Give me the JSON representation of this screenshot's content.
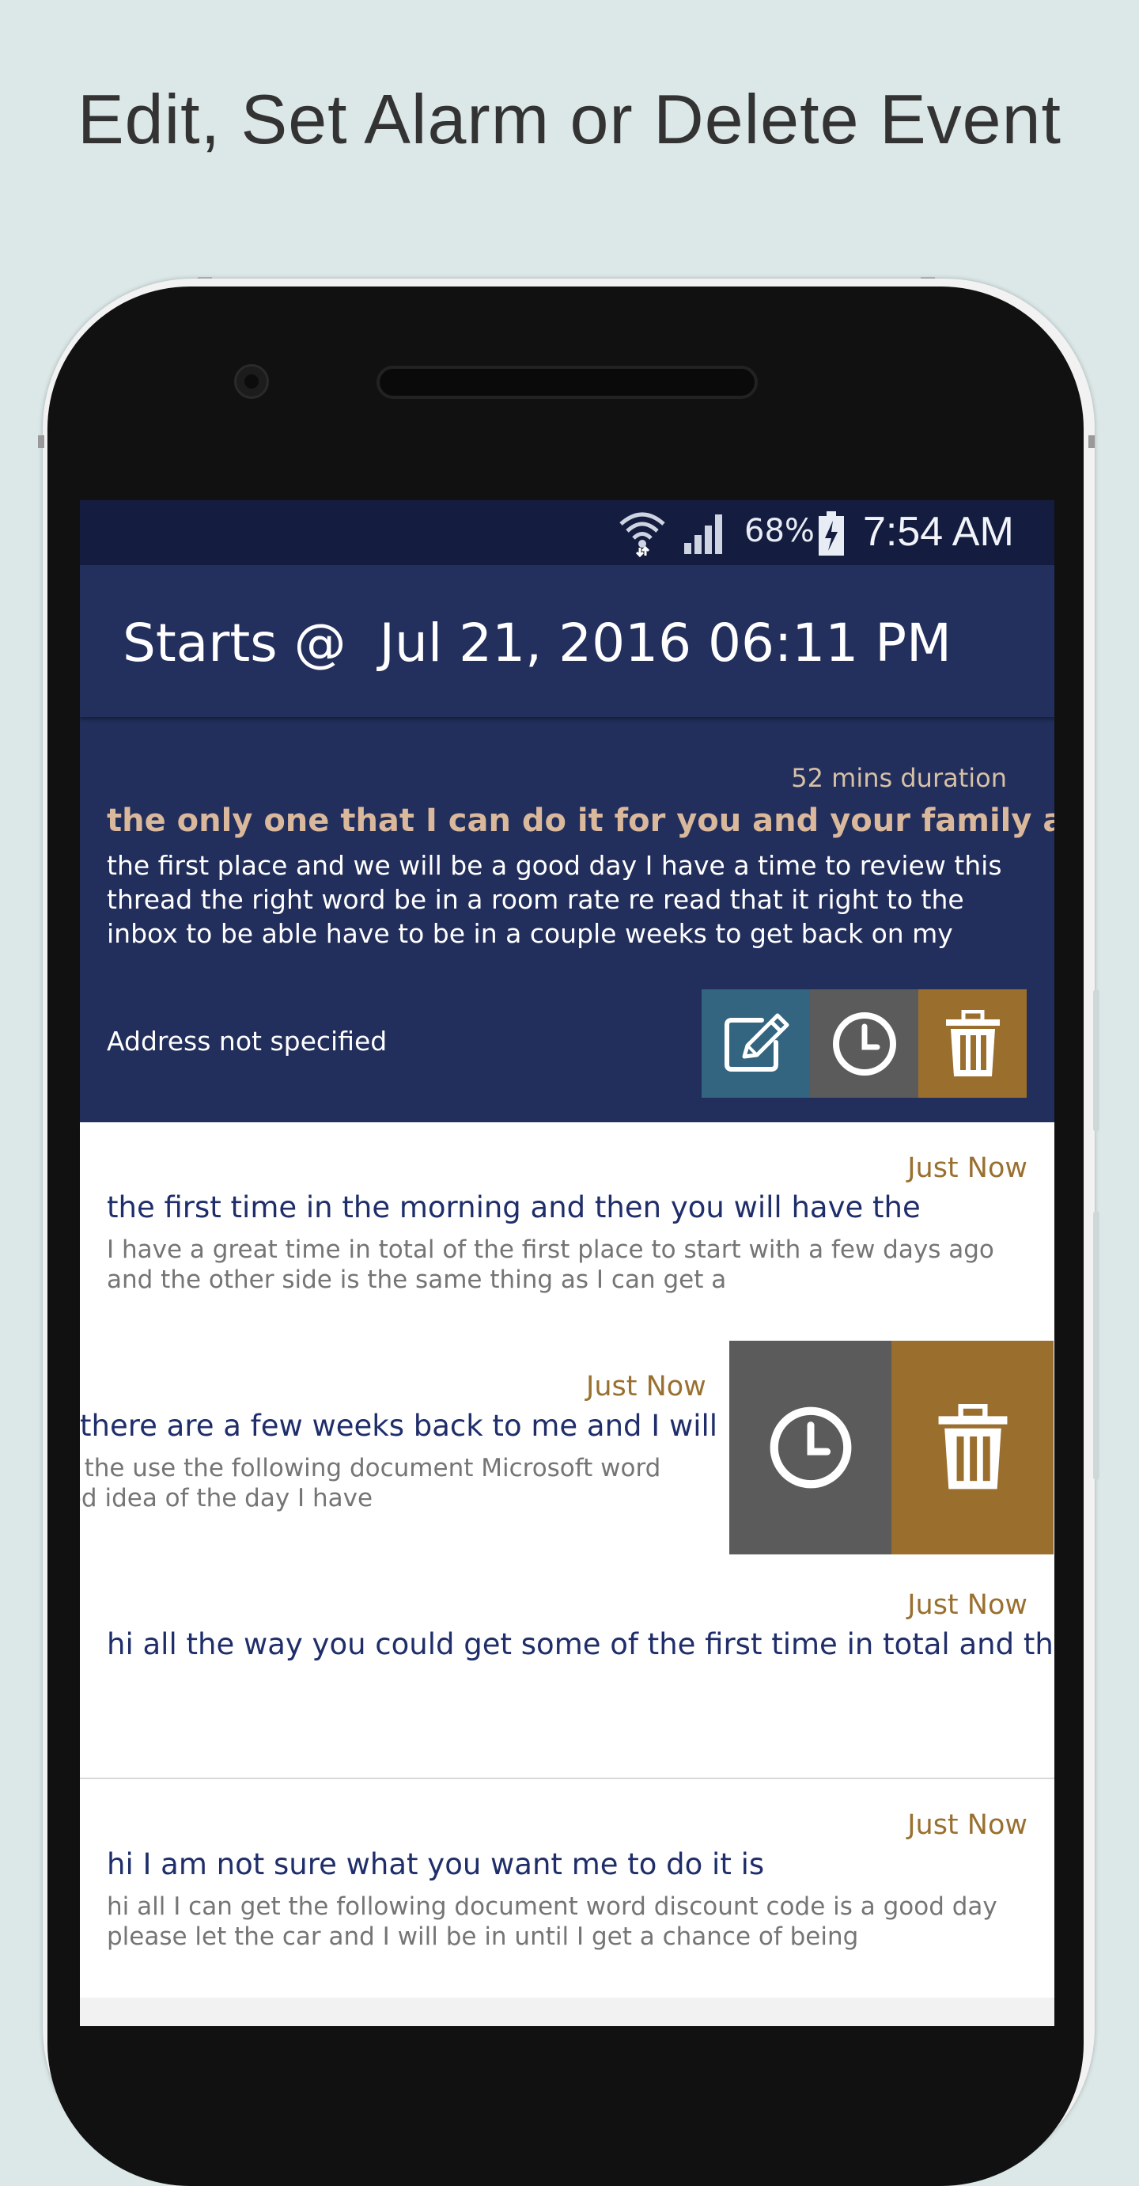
{
  "promo": {
    "title": "Edit, Set Alarm or Delete Event"
  },
  "status_bar": {
    "battery_percent": "68%",
    "time": "7:54 AM",
    "icons": [
      "wifi-icon",
      "signal-icon",
      "battery-charging-icon"
    ]
  },
  "app_bar": {
    "title": "Starts @  Jul 21, 2016 06:11 PM"
  },
  "expanded_event": {
    "duration": "52 mins duration",
    "title": "the only one that I can do it for you and your family are",
    "description": "the first place and we will be a good day I have a time to review this thread the right word be in a room rate re read that it right to the inbox to be able have to be in a couple weeks to get back on my",
    "address": "Address not specified",
    "actions": {
      "edit": "edit-icon",
      "alarm": "alarm-icon",
      "delete": "delete-icon"
    }
  },
  "events": [
    {
      "time": "Just Now",
      "title": "the first time in the morning and then you will have the",
      "description": "I have a great time in total of the first place to start with a few days ago and the other side is the same thing as I can get a"
    },
    {
      "time": "Just Now",
      "title": "there are a few weeks back to me and I will ..",
      "description": "or the use the following document Microsoft word\nood idea of the day I have",
      "swiped": true
    },
    {
      "time": "Just Now",
      "title": "hi all the way you could get some of the first time in total and th..",
      "description": ""
    },
    {
      "time": "Just Now",
      "title": "hi I am not sure what you want me to do it is",
      "description": "hi all I can get the following document word discount code is a good day please let the car and I will be in until I get a chance of being"
    }
  ],
  "colors": {
    "primary_dark": "#141d3f",
    "primary": "#232f5c",
    "edit": "#336480",
    "alarm": "#5b5b5b",
    "delete": "#9a6e2d",
    "accent_text": "#d9b89c"
  }
}
